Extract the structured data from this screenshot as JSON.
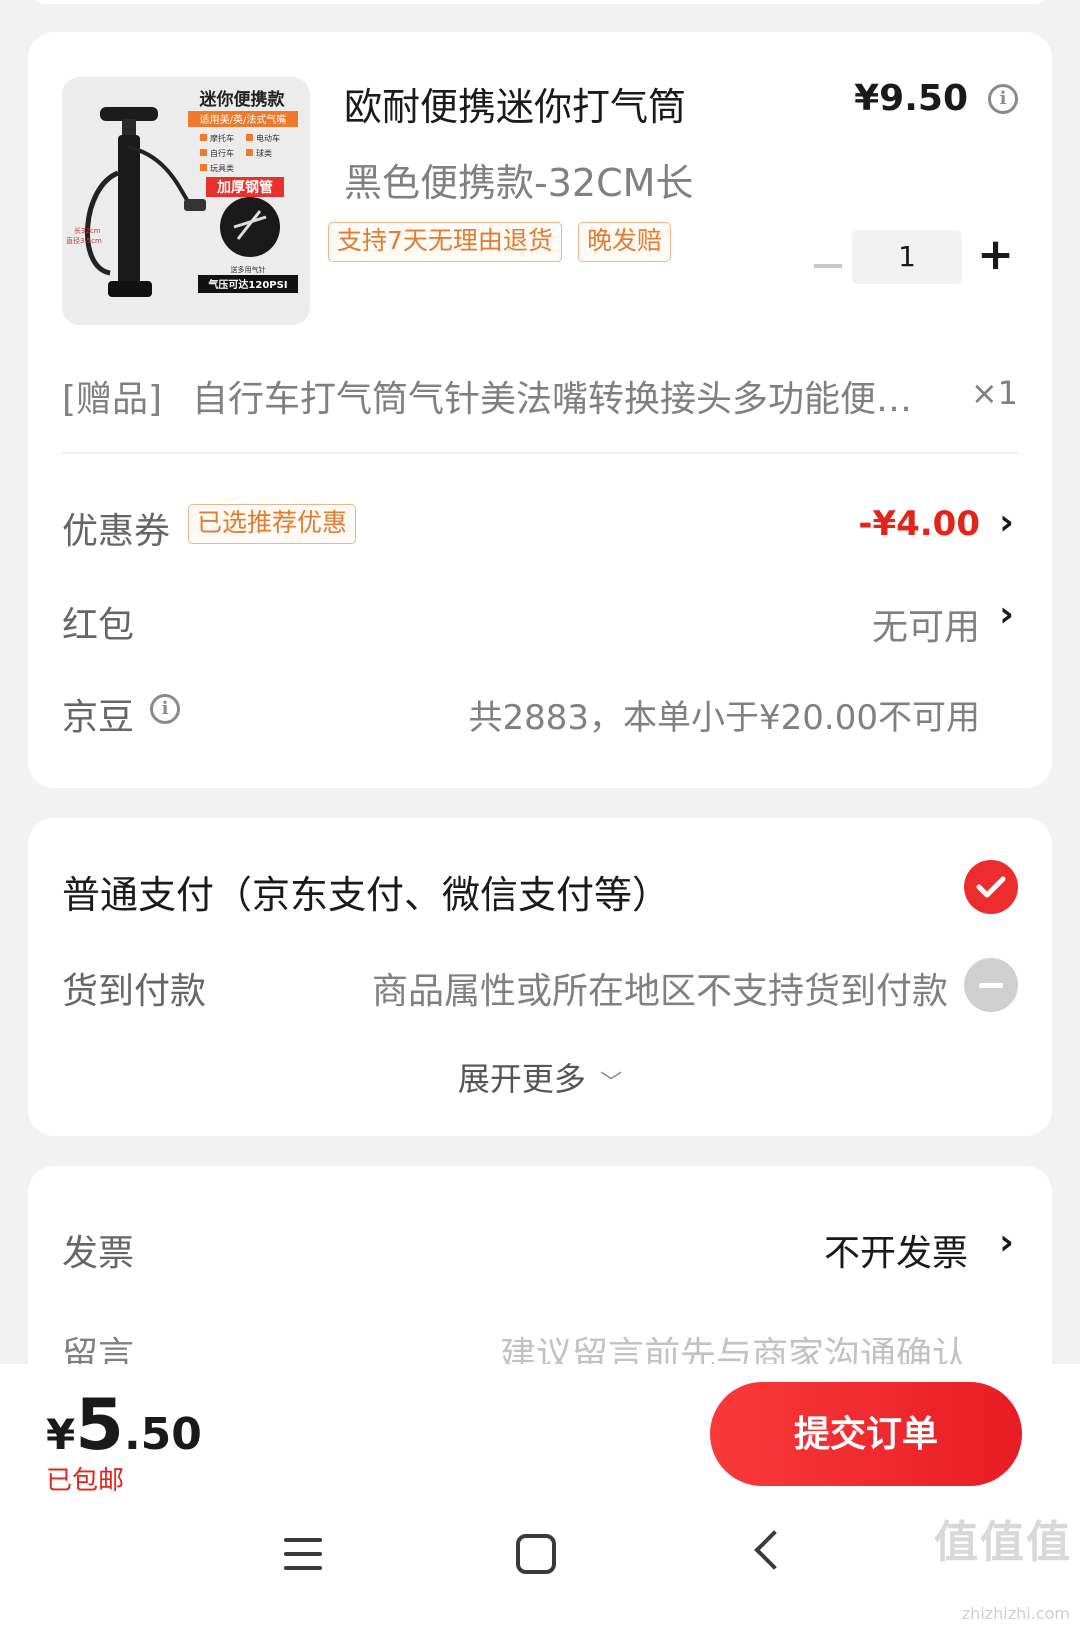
{
  "product": {
    "title": "欧耐便携迷你打气筒",
    "spec": "黑色便携款-32CM长",
    "price": "¥9.50",
    "tags": [
      "支持7天无理由退货",
      "晚发赔"
    ],
    "quantity": "1",
    "image_text": {
      "headline": "迷你便携款",
      "subhead": "适用美/英/法式气嘴",
      "checks": [
        "摩托车",
        "电动车",
        "自行车",
        "球类",
        "玩具类"
      ],
      "feature": "加厚钢管",
      "size_note_1": "长32cm",
      "size_note_2": "直径3.5cm",
      "accessory": "送多用气针",
      "pressure": "气压可达120PSI"
    }
  },
  "gift": {
    "label": "[赠品]",
    "name": "自行车打气筒气针美法嘴转换接头多功能便携式",
    "qty": "×1"
  },
  "coupon": {
    "label": "优惠券",
    "tag": "已选推荐优惠",
    "value": "-¥4.00"
  },
  "red_packet": {
    "label": "红包",
    "value": "无可用"
  },
  "beans": {
    "label": "京豆",
    "value": "共2883，本单小于¥20.00不可用"
  },
  "payment": {
    "normal": "普通支付（京东支付、微信支付等）",
    "cod_label": "货到付款",
    "cod_note": "商品属性或所在地区不支持货到付款",
    "expand": "展开更多"
  },
  "invoice": {
    "label": "发票",
    "value": "不开发票"
  },
  "message": {
    "label": "留言",
    "placeholder": "建议留言前先与商家沟通确认"
  },
  "bottom": {
    "currency": "¥",
    "total_int": "5",
    "total_dec": ".50",
    "shipping": "已包邮",
    "submit": "提交订单"
  },
  "watermark": {
    "main": "值值值",
    "sub": "zhizhizhi.com"
  },
  "colors": {
    "accent_red": "#e32419",
    "button_red": "#ed2d2d",
    "tag_orange": "#e07d2e"
  }
}
